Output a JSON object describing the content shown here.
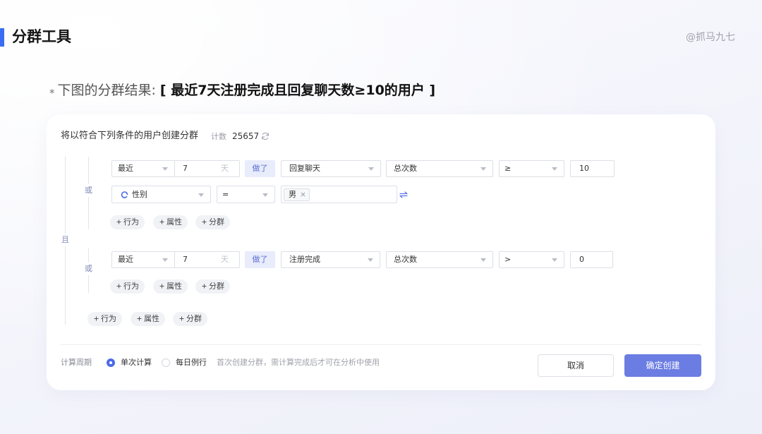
{
  "header": {
    "title": "分群工具",
    "watermark": "@抓马九七"
  },
  "subtitle": {
    "marker": "*",
    "label": "下图的分群结果:",
    "result": "[ 最近7天注册完成且回复聊天数≥10的用户 ]"
  },
  "builder": {
    "heading": "将以符合下列条件的用户创建分群",
    "count_label": "计数",
    "count_value": "25657",
    "refresh_icon": "refresh-icon",
    "group_join": "且",
    "groups": [
      {
        "join": "或",
        "event_condition": {
          "time_range": "最近",
          "days": "7",
          "days_unit": "天",
          "action": "做了",
          "event": "回复聊天",
          "metric": "总次数",
          "operator": "≥",
          "threshold": "10"
        },
        "property_condition": {
          "property_icon": "property-icon",
          "property": "性别",
          "operator": "=",
          "values": [
            "男"
          ],
          "remove_icon": "close-icon",
          "swap_icon": "swap-icon"
        },
        "add_buttons": [
          "行为",
          "属性",
          "分群"
        ]
      },
      {
        "join": "或",
        "event_condition": {
          "time_range": "最近",
          "days": "7",
          "days_unit": "天",
          "action": "做了",
          "event": "注册完成",
          "metric": "总次数",
          "operator": ">",
          "threshold": "0"
        },
        "add_buttons": [
          "行为",
          "属性",
          "分群"
        ]
      }
    ],
    "add_buttons": [
      "行为",
      "属性",
      "分群"
    ],
    "add_icon": "plus-icon",
    "dropdown_icon": "caret-down-icon"
  },
  "footer": {
    "period_label": "计算周期",
    "period_options": [
      {
        "label": "单次计算",
        "selected": true
      },
      {
        "label": "每日例行",
        "selected": false
      }
    ],
    "hint": "首次创建分群，需计算完成后才可在分析中使用",
    "cancel_label": "取消",
    "confirm_label": "确定创建"
  },
  "colors": {
    "accent": "#3B6CF3",
    "primary": "#6B7DE2",
    "action_tag_bg": "#E8ECFB",
    "action_tag_text": "#5B6FD5",
    "join_label": "#7D88B5",
    "radio_selected": "#4C6AE8"
  }
}
